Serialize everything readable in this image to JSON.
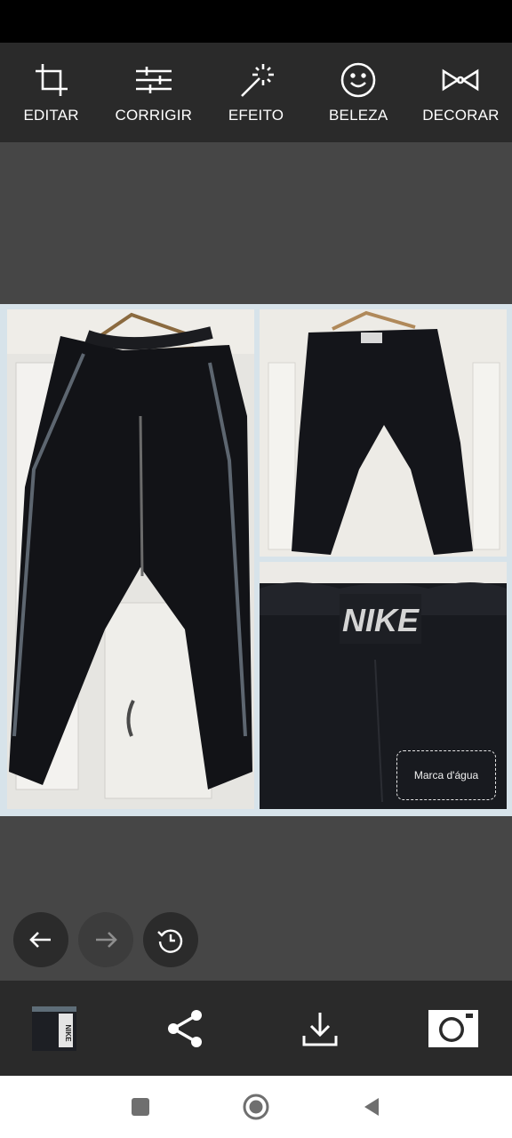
{
  "toolbar": {
    "items": [
      {
        "label": "EDITAR",
        "icon": "crop-icon"
      },
      {
        "label": "CORRIGIR",
        "icon": "sliders-icon"
      },
      {
        "label": "EFEITO",
        "icon": "magic-wand-icon"
      },
      {
        "label": "BELEZA",
        "icon": "smile-icon"
      },
      {
        "label": "DECORAR",
        "icon": "bow-tie-icon"
      }
    ]
  },
  "photo": {
    "brand_text": "NIKE",
    "watermark_label": "Marca d'água"
  },
  "history": {
    "undo_icon": "arrow-left-icon",
    "redo_icon": "arrow-right-icon",
    "history_icon": "history-clock-icon"
  },
  "bottom_bar": {
    "thumb_brand": "NIKE"
  },
  "colors": {
    "toolbar_bg": "#2a2a2a",
    "canvas_bg": "#464646",
    "collage_border": "#d7e3ea"
  }
}
